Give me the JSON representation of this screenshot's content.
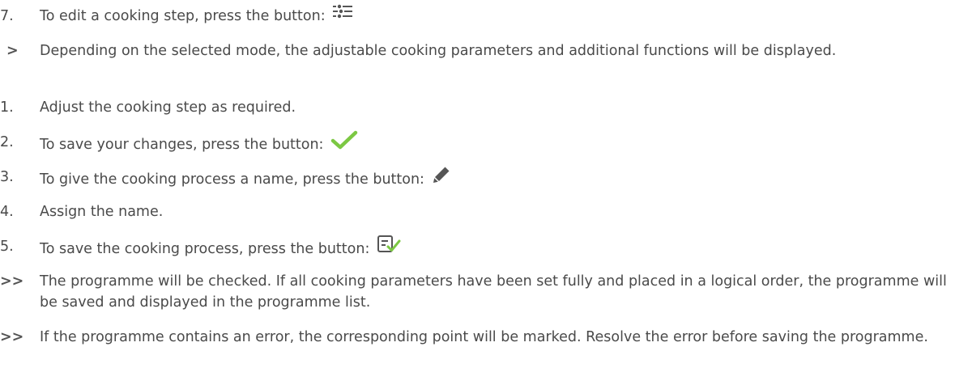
{
  "steps": [
    {
      "marker": "7.",
      "text": "To edit a cooking step, press the button:",
      "icon": "sliders-icon"
    },
    {
      "marker": ">",
      "text": "Depending on the selected mode, the adjustable cooking parameters and additional functions will be displayed."
    },
    {
      "marker": "1.",
      "text": "Adjust the cooking step as required."
    },
    {
      "marker": "2.",
      "text": "To save your changes, press the button:",
      "icon": "checkmark-icon"
    },
    {
      "marker": "3.",
      "text": "To give the cooking process a name, press the button:",
      "icon": "pencil-icon"
    },
    {
      "marker": "4.",
      "text": "Assign the name."
    },
    {
      "marker": "5.",
      "text": "To save the cooking process, press the button:",
      "icon": "save-document-icon"
    },
    {
      "marker": ">>",
      "text": "The programme will be checked. If all cooking parameters have been set fully and placed in a logical order, the programme will be saved and displayed in the programme list."
    },
    {
      "marker": ">>",
      "text": "If the programme contains an error, the corresponding point will be marked. Resolve the error before saving the programme."
    }
  ],
  "colors": {
    "text": "#4a4a4a",
    "check_green": "#7cc843",
    "icon_gray": "#555555"
  }
}
